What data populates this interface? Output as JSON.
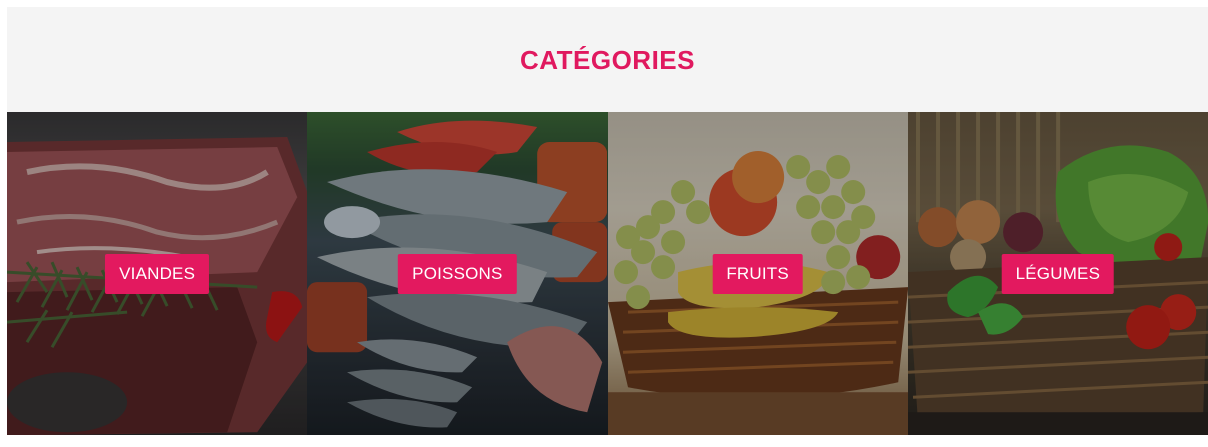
{
  "section": {
    "title": "CATÉGORIES"
  },
  "categories": [
    {
      "label": "VIANDES"
    },
    {
      "label": "POISSONS"
    },
    {
      "label": "FRUITS"
    },
    {
      "label": "LÉGUMES"
    }
  ],
  "colors": {
    "accent": "#e3195f",
    "section_background": "#f4f4f4"
  }
}
